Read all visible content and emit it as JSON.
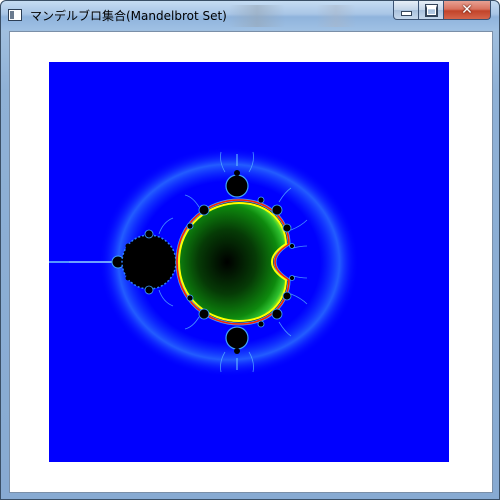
{
  "window": {
    "title": "マンデルブロ集合(Mandelbrot Set)",
    "icon": "app-window-icon"
  },
  "controls": {
    "minimize_icon": "minimize-icon",
    "maximize_icon": "maximize-icon",
    "close_icon": "close-icon",
    "close_glyph": "✕"
  },
  "colors": {
    "background_blue": "#0000ff",
    "set_interior_green": "#0b7a0b",
    "set_dark": "#000000",
    "boundary_yellow": "#ffff00",
    "boundary_red": "#ff2000",
    "filament_cyan": "#40a0ff"
  }
}
